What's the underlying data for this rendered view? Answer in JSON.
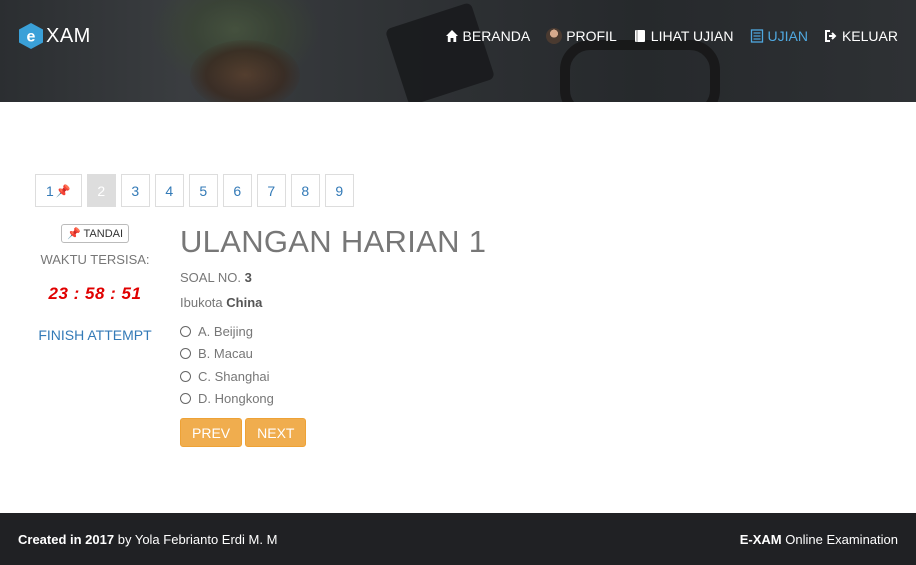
{
  "header": {
    "logo_letter": "e",
    "logo_text": "XAM",
    "nav": [
      {
        "label": "BERANDA",
        "icon": "home-icon",
        "active": false
      },
      {
        "label": "PROFIL",
        "icon": "avatar",
        "active": false
      },
      {
        "label": "LIHAT UJIAN",
        "icon": "book-icon",
        "active": false
      },
      {
        "label": "UJIAN",
        "icon": "list-icon",
        "active": true
      },
      {
        "label": "KELUAR",
        "icon": "sign-out-icon",
        "active": false
      }
    ]
  },
  "pagination": {
    "pages": [
      "1",
      "2",
      "3",
      "4",
      "5",
      "6",
      "7",
      "8",
      "9"
    ],
    "active": "2",
    "marked": "1"
  },
  "side": {
    "tandai_label": "TANDAI",
    "waktu_label": "WAKTU TERSISA:",
    "timer": "23 : 58 : 51",
    "finish_label": "FINISH ATTEMPT"
  },
  "question": {
    "exam_title": "ULANGAN HARIAN 1",
    "soal_prefix": "SOAL NO.",
    "soal_number": "3",
    "text_prefix": "Ibukota",
    "text_bold": "China",
    "options": [
      "A. Beijing",
      "B. Macau",
      "C. Shanghai",
      "D. Hongkong"
    ],
    "prev_label": "PREV",
    "next_label": "NEXT"
  },
  "footer": {
    "created_prefix": "Created in 2017",
    "created_by": "by Yola Febrianto Erdi M. M",
    "brand_bold": "E-XAM",
    "brand_rest": "Online Examination"
  },
  "colors": {
    "accent": "#337ab7",
    "active_nav": "#4fa8e0",
    "timer": "#e00000",
    "button": "#f0ad4e",
    "footer_bg": "#202124"
  }
}
